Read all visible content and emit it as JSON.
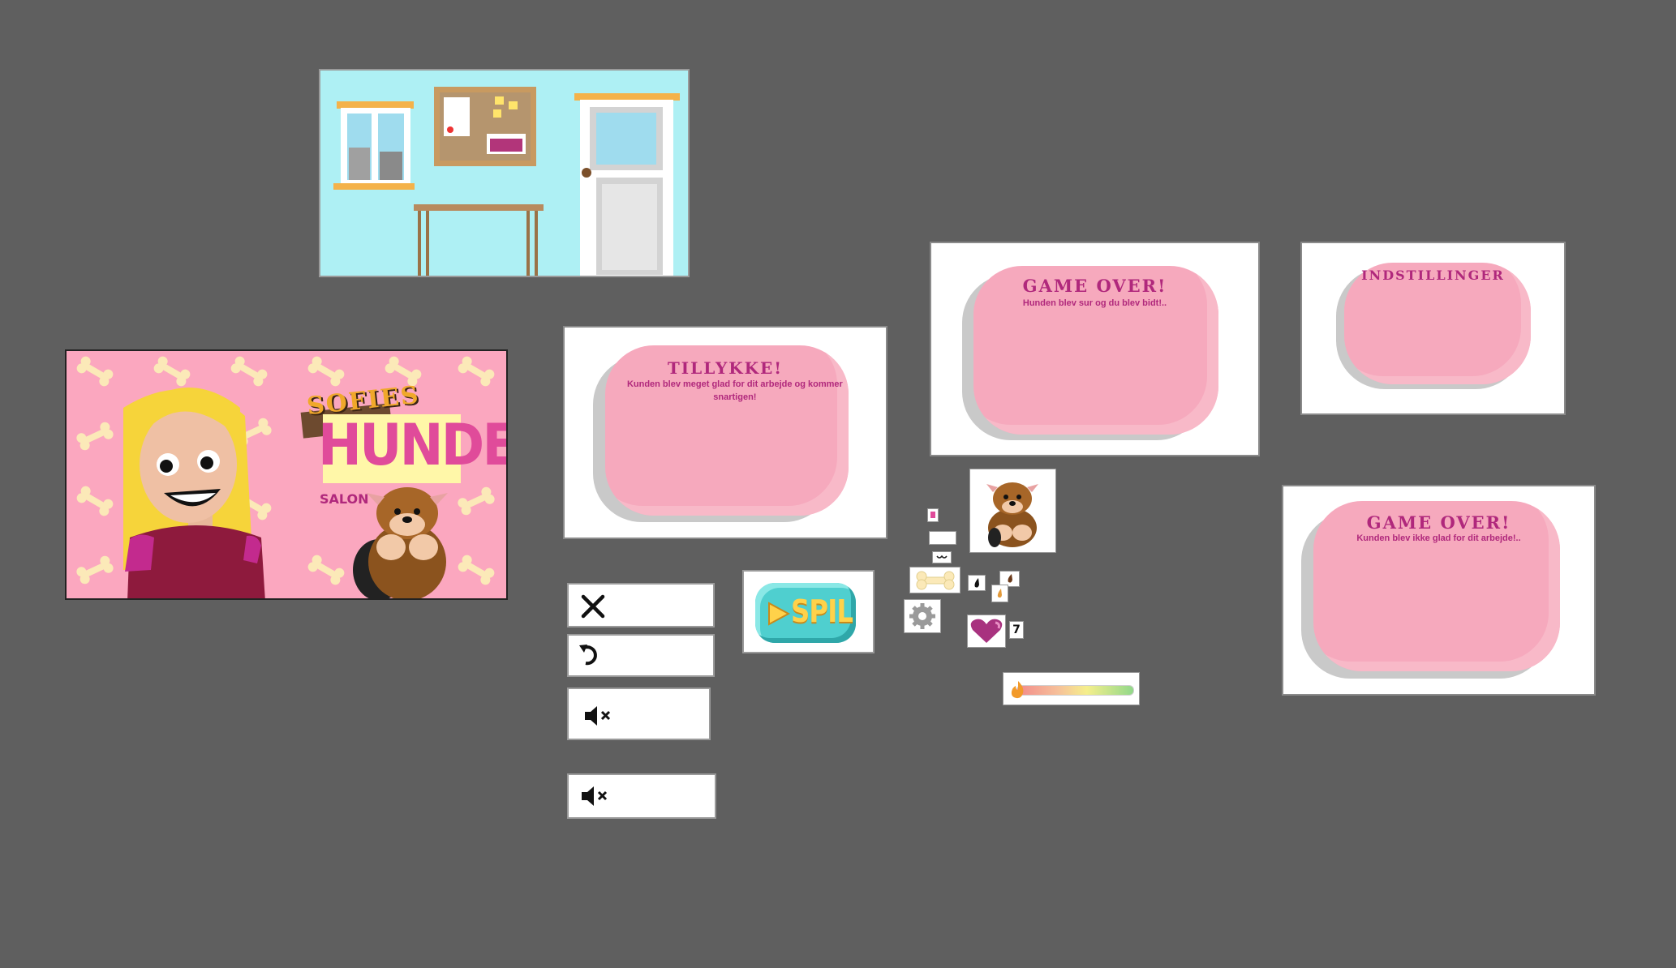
{
  "sprites": {
    "title_screen": {
      "logo_line1": "SOFIES",
      "logo_line2": "HUNDE",
      "logo_line3": "SALON"
    },
    "dialog_success": {
      "title": "TILLYKKE!",
      "subtitle": "Kunden blev meget glad for dit arbejde og kommer snartigen!"
    },
    "dialog_gameover_bite": {
      "title": "GAME OVER!",
      "subtitle": "Hunden blev sur og du blev bidt!.."
    },
    "dialog_settings": {
      "title": "INDSTILLINGER"
    },
    "dialog_gameover_unhappy": {
      "title": "GAME OVER!",
      "subtitle": "Kunden blev ikke glad for dit arbejde!.."
    },
    "play_button": {
      "label": "SPIL"
    },
    "lives_counter": {
      "value": "7"
    }
  },
  "colors": {
    "canvas_bg": "#5f5f5f",
    "dialog_pink": "#f6a9bd",
    "dialog_text": "#b0287c",
    "title_pink": "#fba7bf",
    "room_wall": "#aef0f4",
    "play_teal": "#4fcfcf",
    "play_text": "#ffd24a"
  },
  "icons": [
    "close-icon",
    "restart-icon",
    "mute-icon",
    "mute-icon",
    "bone-icon",
    "gear-icon",
    "heart-icon",
    "dog-icon"
  ]
}
